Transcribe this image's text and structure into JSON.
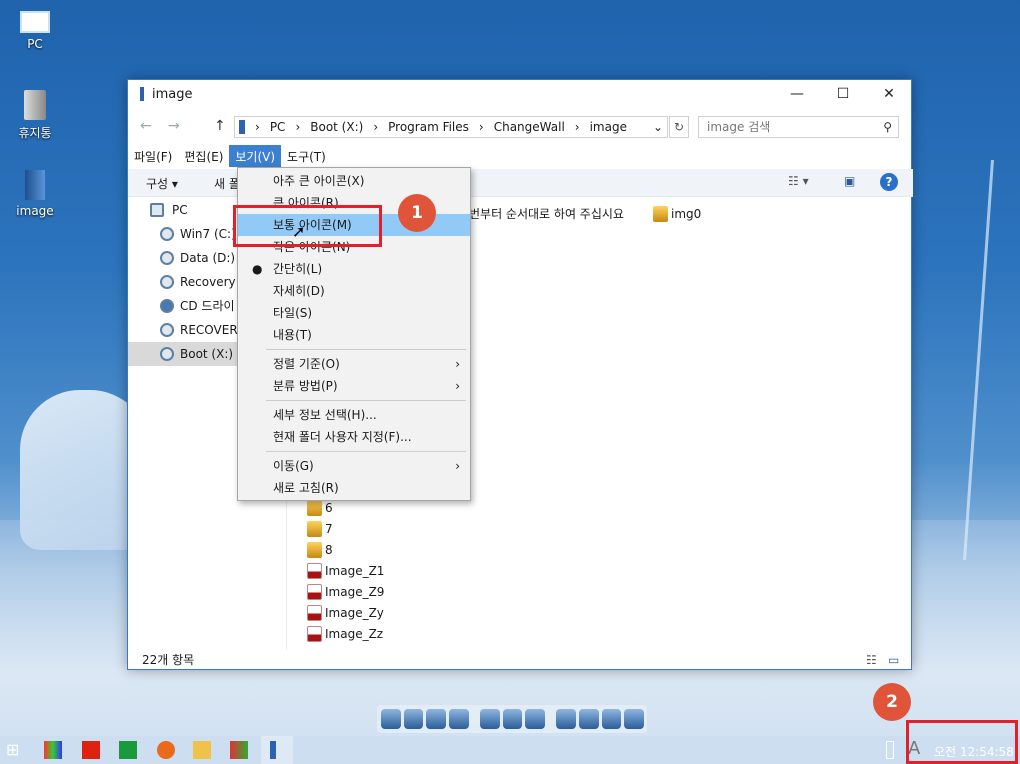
{
  "desktop": {
    "icons": [
      {
        "label": "PC"
      },
      {
        "label": "휴지통"
      },
      {
        "label": "image"
      }
    ]
  },
  "window": {
    "title": "image",
    "address": {
      "segments": [
        "PC",
        "Boot (X:)",
        "Program Files",
        "ChangeWall",
        "image"
      ],
      "search_placeholder": "image 검색"
    },
    "menubar": [
      "파일(F)",
      "편집(E)",
      "보기(V)",
      "도구(T)"
    ],
    "toolbar": {
      "organize": "구성 ▾",
      "new_folder": "새 폴"
    },
    "nav": [
      "PC",
      "Win7 (C:)",
      "Data (D:)",
      "Recovery (",
      "CD 드라이",
      "RECOVERY",
      "Boot (X:)"
    ],
    "files": {
      "header_text": "번부터 순서대로 하여 주십시요",
      "img0": "img0",
      "items": [
        "6",
        "7",
        "8",
        "Image_Z1",
        "Image_Z9",
        "Image_Zy",
        "Image_Zz"
      ]
    },
    "status": "22개 항목"
  },
  "view_menu": {
    "items": [
      "아주 큰 아이콘(X)",
      "큰 아이콘(R)",
      "보통 아이콘(M)",
      "작은 아이콘(N)",
      "간단히(L)",
      "자세히(D)",
      "타일(S)",
      "내용(T)",
      "정렬 기준(O)",
      "분류 방법(P)",
      "세부 정보 선택(H)...",
      "현재 폴더 사용자 지정(F)...",
      "이동(G)",
      "새로 고침(R)"
    ]
  },
  "badges": [
    "1",
    "2"
  ],
  "taskbar": {
    "clock": "오전 12:54:58",
    "ime": "A"
  }
}
